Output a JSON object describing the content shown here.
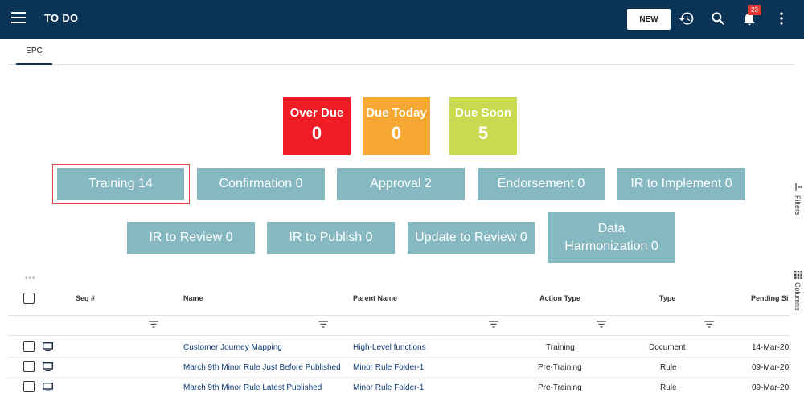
{
  "header": {
    "title": "TO DO",
    "new_label": "NEW",
    "notification_count": "23"
  },
  "tabs": [
    {
      "label": "EPC"
    }
  ],
  "summary": [
    {
      "label": "Over Due",
      "value": "0",
      "color": "#ee1c25"
    },
    {
      "label": "Due Today",
      "value": "0",
      "color": "#f7a733"
    },
    {
      "label": "Due Soon",
      "value": "5",
      "color": "#c8d952"
    }
  ],
  "categories": [
    {
      "label": "Training 14",
      "selected": true
    },
    {
      "label": "Confirmation 0"
    },
    {
      "label": "Approval 2"
    },
    {
      "label": "Endorsement 0"
    },
    {
      "label": "IR to Implement 0"
    },
    {
      "label": "IR to Review 0"
    },
    {
      "label": "IR to Publish 0"
    },
    {
      "label": "Update to Review 0"
    },
    {
      "label": "Data Harmonization 0"
    }
  ],
  "side_panels": {
    "filters": "Filters",
    "columns": "Columns"
  },
  "table": {
    "columns": [
      "Seq #",
      "Name",
      "Parent Name",
      "Action Type",
      "Type",
      "Pending Si"
    ],
    "rows": [
      {
        "name": "Customer Journey Mapping",
        "parent": "High-Level functions",
        "action": "Training",
        "type": "Document",
        "pending": "14-Mar-20"
      },
      {
        "name": "March 9th Minor Rule Just Before Published",
        "parent": "Minor Rule Folder-1",
        "action": "Pre-Training",
        "type": "Rule",
        "pending": "09-Mar-20"
      },
      {
        "name": "March 9th Minor Rule Latest Published",
        "parent": "Minor Rule Folder-1",
        "action": "Pre-Training",
        "type": "Rule",
        "pending": "09-Mar-20"
      }
    ]
  },
  "colors": {
    "header_bg": "#0b3356",
    "category_bg": "#86b8c1",
    "selection_outline": "#e04a3f"
  }
}
